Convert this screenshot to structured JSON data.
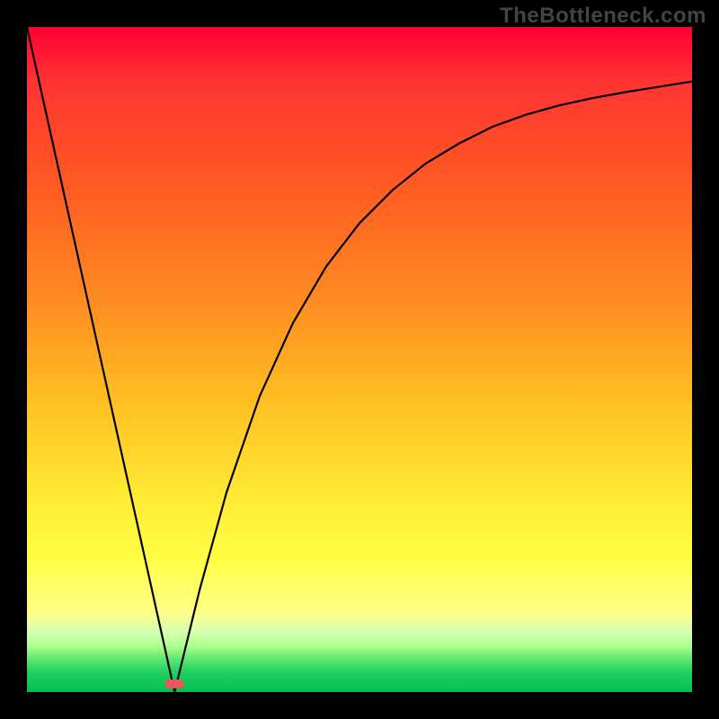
{
  "watermark": "TheBottleneck.com",
  "colors": {
    "frame_bg": "#000000",
    "watermark_text": "#444444",
    "curve_stroke": "#000000",
    "marker_fill": "#e85a5a"
  },
  "chart_data": {
    "type": "line",
    "title": "",
    "xlabel": "",
    "ylabel": "",
    "xlim": [
      0,
      1
    ],
    "ylim": [
      0,
      1
    ],
    "series": [
      {
        "name": "left-line",
        "x": [
          0.0,
          0.222
        ],
        "y": [
          1.0,
          0.0
        ]
      },
      {
        "name": "right-curve",
        "x": [
          0.222,
          0.26,
          0.3,
          0.35,
          0.4,
          0.45,
          0.5,
          0.55,
          0.6,
          0.65,
          0.7,
          0.75,
          0.8,
          0.85,
          0.9,
          0.95,
          1.0
        ],
        "y": [
          0.0,
          0.155,
          0.3,
          0.445,
          0.555,
          0.64,
          0.705,
          0.755,
          0.795,
          0.825,
          0.85,
          0.868,
          0.882,
          0.893,
          0.902,
          0.91,
          0.918
        ]
      }
    ],
    "marker": {
      "x": 0.222,
      "y": 0.012,
      "shape": "pill"
    },
    "background_gradient": {
      "direction": "vertical",
      "stops": [
        {
          "pos": 0.0,
          "color": "#ff0033"
        },
        {
          "pos": 0.08,
          "color": "#ff3333"
        },
        {
          "pos": 0.22,
          "color": "#ff5522"
        },
        {
          "pos": 0.4,
          "color": "#ff8822"
        },
        {
          "pos": 0.55,
          "color": "#ffbb22"
        },
        {
          "pos": 0.7,
          "color": "#ffe833"
        },
        {
          "pos": 0.8,
          "color": "#ffff44"
        },
        {
          "pos": 0.88,
          "color": "#ffff88"
        },
        {
          "pos": 0.91,
          "color": "#d4ffb0"
        },
        {
          "pos": 0.93,
          "color": "#b0ff90"
        },
        {
          "pos": 0.95,
          "color": "#60e870"
        },
        {
          "pos": 0.97,
          "color": "#20d060"
        },
        {
          "pos": 1.0,
          "color": "#00c050"
        }
      ]
    }
  }
}
